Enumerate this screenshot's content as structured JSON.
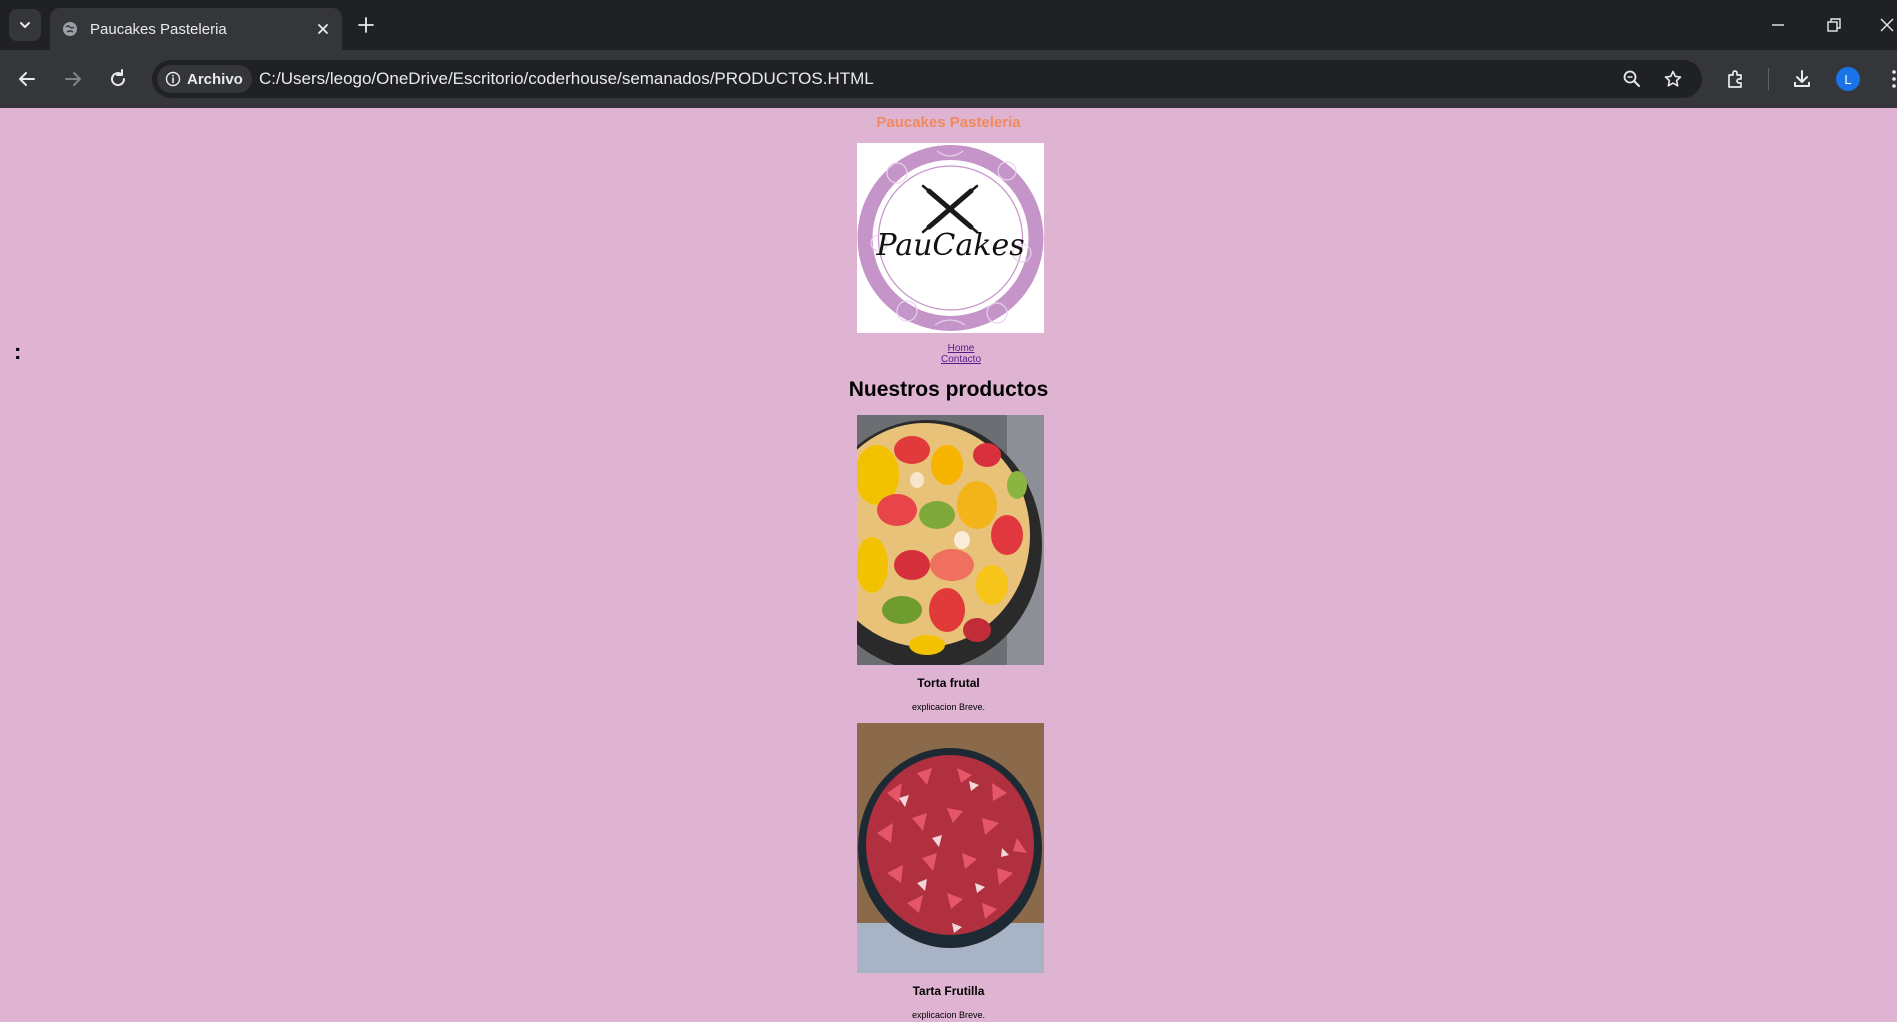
{
  "browser": {
    "tab_title": "Paucakes Pasteleria",
    "site_chip_label": "Archivo",
    "url": "C:/Users/leogo/OneDrive/Escritorio/coderhouse/semanados/PRODUCTOS.HTML",
    "avatar_letter": "L"
  },
  "page": {
    "stray_text": ":",
    "site_title": "Paucakes Pasteleria",
    "logo_text": "PauCakes",
    "nav": [
      {
        "label": "Home"
      },
      {
        "label": "Contacto"
      }
    ],
    "section_title": "Nuestros productos",
    "products": [
      {
        "name": "Torta frutal",
        "description": "explicacion Breve."
      },
      {
        "name": "Tarta Frutilla",
        "description": "explicacion Breve."
      }
    ]
  },
  "colors": {
    "page_background": "#dfb4d3",
    "site_title": "#f08a5d",
    "logo_ring": "#c594c8"
  }
}
